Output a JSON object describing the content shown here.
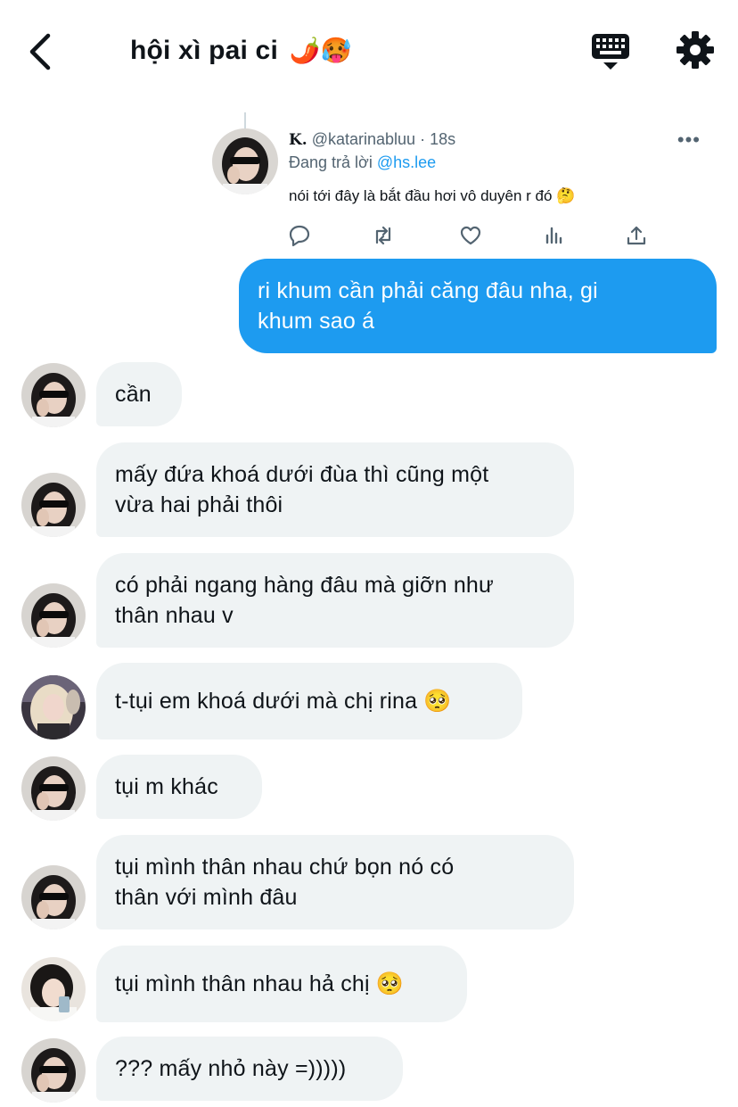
{
  "header": {
    "title": "hội xì pai ci",
    "title_emoji": "🌶️🥵",
    "back_icon": "chevron-left-icon",
    "keyboard_icon": "keyboard-icon",
    "settings_icon": "gear-icon"
  },
  "tweet": {
    "name": "K.",
    "handle": "@katarinabluu",
    "separator": "·",
    "time": "18s",
    "reply_prefix": "Đang trả lời",
    "reply_mention": "@hs.lee",
    "text": "nói tới đây là bắt đầu hơi vô duyên r đó",
    "text_emoji": "🤔",
    "more": "•••",
    "actions": [
      "reply-icon",
      "retweet-icon",
      "like-icon",
      "analytics-icon",
      "share-icon"
    ]
  },
  "messages": [
    {
      "side": "out",
      "lines": [
        "ri khum cần phải căng đâu nha, gi",
        "khum sao á"
      ]
    },
    {
      "side": "in",
      "avatar": "avatar-katarina",
      "lines": [
        "cần"
      ]
    },
    {
      "side": "in",
      "avatar": "avatar-katarina",
      "lines": [
        "mấy đứa khoá dưới đùa thì cũng một",
        "vừa hai phải thôi"
      ]
    },
    {
      "side": "in",
      "avatar": "avatar-katarina",
      "lines": [
        "có phải ngang hàng đâu mà giỡn như",
        "thân nhau v"
      ]
    },
    {
      "side": "in",
      "avatar": "avatar-blonde",
      "lines": [
        "t-tụi em khoá dưới mà chị rina"
      ],
      "emoji": "🥺"
    },
    {
      "side": "in",
      "avatar": "avatar-katarina",
      "lines": [
        "tụi m khác"
      ]
    },
    {
      "side": "in",
      "avatar": "avatar-katarina",
      "lines": [
        "tụi mình thân nhau chứ bọn nó có",
        "thân với mình đâu"
      ]
    },
    {
      "side": "in",
      "avatar": "avatar-braids",
      "lines": [
        "tụi mình thân nhau hả chị"
      ],
      "emoji": "🥺"
    },
    {
      "side": "in",
      "avatar": "avatar-katarina",
      "lines": [
        "??? mấy nhỏ này =)))))"
      ]
    }
  ],
  "colors": {
    "accent": "#1d9bf0",
    "incoming_bubble": "#eff3f4",
    "text": "#0f1419",
    "muted": "#536471"
  }
}
